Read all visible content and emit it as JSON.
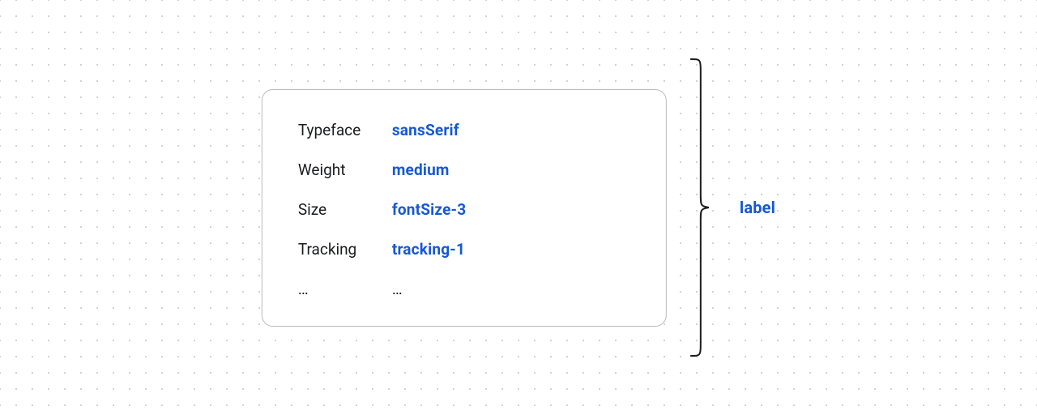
{
  "panel": {
    "rows": [
      {
        "key": "Typeface",
        "value": "sansSerif"
      },
      {
        "key": "Weight",
        "value": "medium"
      },
      {
        "key": "Size",
        "value": "fontSize-3"
      },
      {
        "key": "Tracking",
        "value": "tracking-1"
      }
    ],
    "more_key": "…",
    "more_value": "…"
  },
  "alias_label": "label"
}
